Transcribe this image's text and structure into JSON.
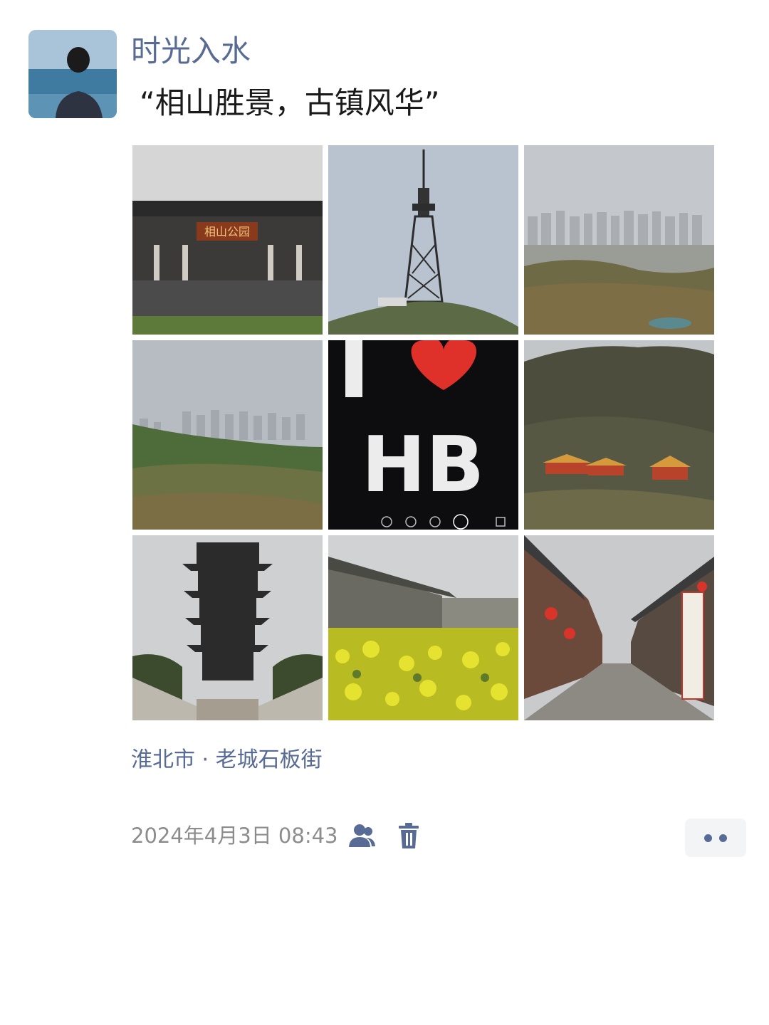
{
  "post": {
    "username": "时光入水",
    "text": "“相山胜景，古镇风华”",
    "location": "淮北市 · 老城石板街",
    "timestamp": "2024年4月3日 08:43"
  },
  "photos": [
    {
      "name": "park-gate-photo",
      "sign_text": "相山公园"
    },
    {
      "name": "tv-tower-photo"
    },
    {
      "name": "city-skyline-photo"
    },
    {
      "name": "hillside-city-photo"
    },
    {
      "name": "i-love-hb-photo",
      "caption_letters": "HB"
    },
    {
      "name": "mountain-temple-photo"
    },
    {
      "name": "pagoda-photo"
    },
    {
      "name": "rapeseed-field-photo"
    },
    {
      "name": "old-street-photo"
    }
  ],
  "icons": {
    "visibility": "friends-visibility-icon",
    "delete": "trash-icon",
    "more": "more-dots-icon"
  },
  "colors": {
    "link": "#576b95",
    "text": "#1a1a1a",
    "meta": "#8c8c8c"
  }
}
